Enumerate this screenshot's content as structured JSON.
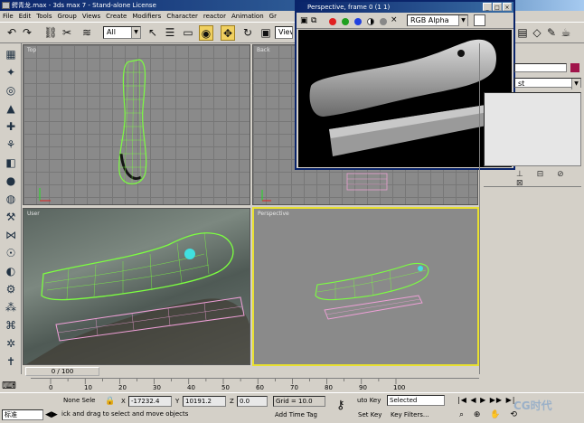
{
  "window": {
    "title": "鳄青龙.max - 3ds max 7  - Stand-alone License"
  },
  "menu": [
    "File",
    "Edit",
    "Tools",
    "Group",
    "Views",
    "Create",
    "Modifiers",
    "Character",
    "reactor",
    "Animation",
    "Gr"
  ],
  "toolbar": {
    "selection_filter": "All",
    "view_combo": "View"
  },
  "viewports": {
    "top": "Top",
    "back": "Back",
    "user": "User",
    "perspective": "Perspective"
  },
  "render_window": {
    "title": "Perspective, frame 0 (1 1)",
    "channel": "RGB Alpha"
  },
  "command_panel": {
    "dropdown_text": "st"
  },
  "time": {
    "slider": "0 / 100",
    "ticks": [
      "0",
      "10",
      "20",
      "30",
      "40",
      "50",
      "60",
      "70",
      "80",
      "90",
      "100"
    ]
  },
  "status": {
    "selection": "None Sele",
    "coord_x_label": "X",
    "coord_x": "-17232.4",
    "coord_y_label": "Y",
    "coord_y": "10191.2",
    "coord_z_label": "Z",
    "coord_z": "0.0",
    "grid": "Grid = 10.0",
    "prompt": "ick and drag to select and move objects",
    "add_time_tag": "Add Time Tag",
    "auto_key": "uto Key",
    "set_key": "Set Key",
    "key_mode": "Selected",
    "key_filters": "Key Filters...",
    "max_script": "标准"
  },
  "colors": {
    "accent": "#f0d060",
    "active_border": "#e8e030",
    "title_blue": "#0a246a",
    "wire_green": "#7cff40",
    "object_color": "#a0144a"
  },
  "watermark": "CG时代"
}
